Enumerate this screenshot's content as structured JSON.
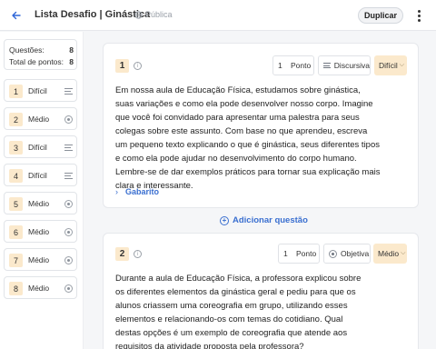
{
  "topbar": {
    "title": "Lista Desafio | Ginástica",
    "visibility": "Pública",
    "duplicate_label": "Duplicar"
  },
  "sidebar": {
    "questions_label": "Questões:",
    "questions_count": "8",
    "points_label": "Total de pontos:",
    "points_count": "8",
    "items": [
      {
        "number": "1",
        "level": "Difícil",
        "type": "discursive"
      },
      {
        "number": "2",
        "level": "Médio",
        "type": "objective"
      },
      {
        "number": "3",
        "level": "Difícil",
        "type": "discursive"
      },
      {
        "number": "4",
        "level": "Difícil",
        "type": "discursive"
      },
      {
        "number": "5",
        "level": "Médio",
        "type": "objective"
      },
      {
        "number": "6",
        "level": "Médio",
        "type": "objective"
      },
      {
        "number": "7",
        "level": "Médio",
        "type": "objective"
      },
      {
        "number": "8",
        "level": "Médio",
        "type": "objective"
      }
    ]
  },
  "questions": [
    {
      "number": "1",
      "points_value": "1",
      "points_unit": "Ponto",
      "type_label": "Discursiva",
      "difficulty": "Difícil",
      "text": "Em nossa aula de Educação Física, estudamos sobre ginástica, suas variações e como ela pode desenvolver nosso corpo. Imagine que você foi convidado para apresentar uma palestra para seus colegas sobre este assunto. Com base no que aprendeu, escreva um pequeno texto explicando o que é ginástica, seus diferentes tipos e como ela pode ajudar no desenvolvimento do corpo humano. Lembre-se de dar exemplos práticos para tornar sua explicação mais clara e interessante.",
      "answer_key_label": "Gabarito"
    },
    {
      "number": "2",
      "points_value": "1",
      "points_unit": "Ponto",
      "type_label": "Objetiva",
      "difficulty": "Médio",
      "text": "Durante a aula de Educação Física, a professora explicou sobre os diferentes elementos da ginástica geral e pediu para que os alunos criassem uma coreografia em grupo, utilizando esses elementos e relacionando-os com temas do cotidiano. Qual destas opções é um exemplo de coreografia que atende aos requisitos da atividade proposta pela professora?"
    }
  ],
  "add_question_label": "Adicionar questão",
  "colors": {
    "accent": "#3a6fd0",
    "badge": "#fbe9cc"
  }
}
